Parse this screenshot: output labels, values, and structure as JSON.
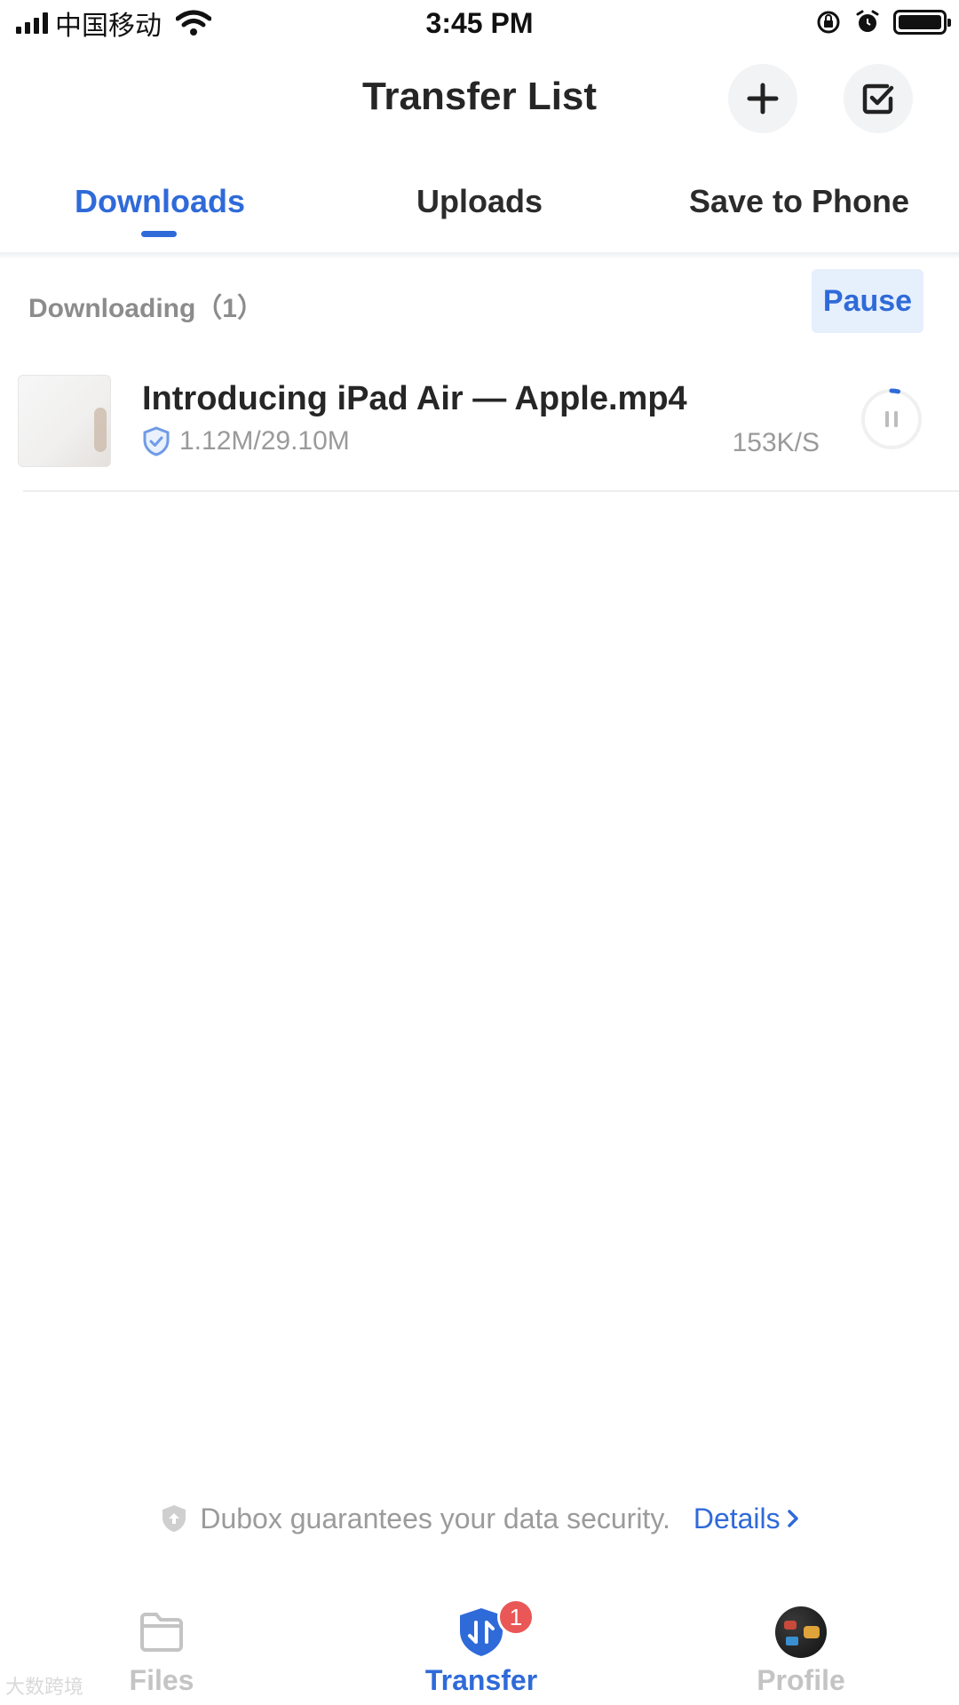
{
  "status_bar": {
    "carrier": "中国移动",
    "time": "3:45 PM"
  },
  "header": {
    "title": "Transfer List",
    "add_icon": "plus-icon",
    "select_icon": "checkbox-edit-icon"
  },
  "tabs": [
    {
      "label": "Downloads",
      "active": true
    },
    {
      "label": "Uploads",
      "active": false
    },
    {
      "label": "Save to Phone",
      "active": false
    }
  ],
  "section": {
    "title": "Downloading（1）",
    "action_label": "Pause"
  },
  "items": [
    {
      "name": "Introducing iPad Air — Apple.mp4",
      "progress_text": "1.12M/29.10M",
      "speed": "153K/S",
      "progress_fraction": 0.038
    }
  ],
  "security": {
    "message": "Dubox guarantees your data security.",
    "link_label": "Details"
  },
  "tabbar": [
    {
      "label": "Files",
      "icon": "folder-icon",
      "active": false
    },
    {
      "label": "Transfer",
      "icon": "transfer-icon",
      "active": true,
      "badge": "1"
    },
    {
      "label": "Profile",
      "icon": "avatar",
      "active": false
    }
  ],
  "watermark": "大数跨境",
  "colors": {
    "accent": "#2f6ad9",
    "badge": "#e95757"
  }
}
